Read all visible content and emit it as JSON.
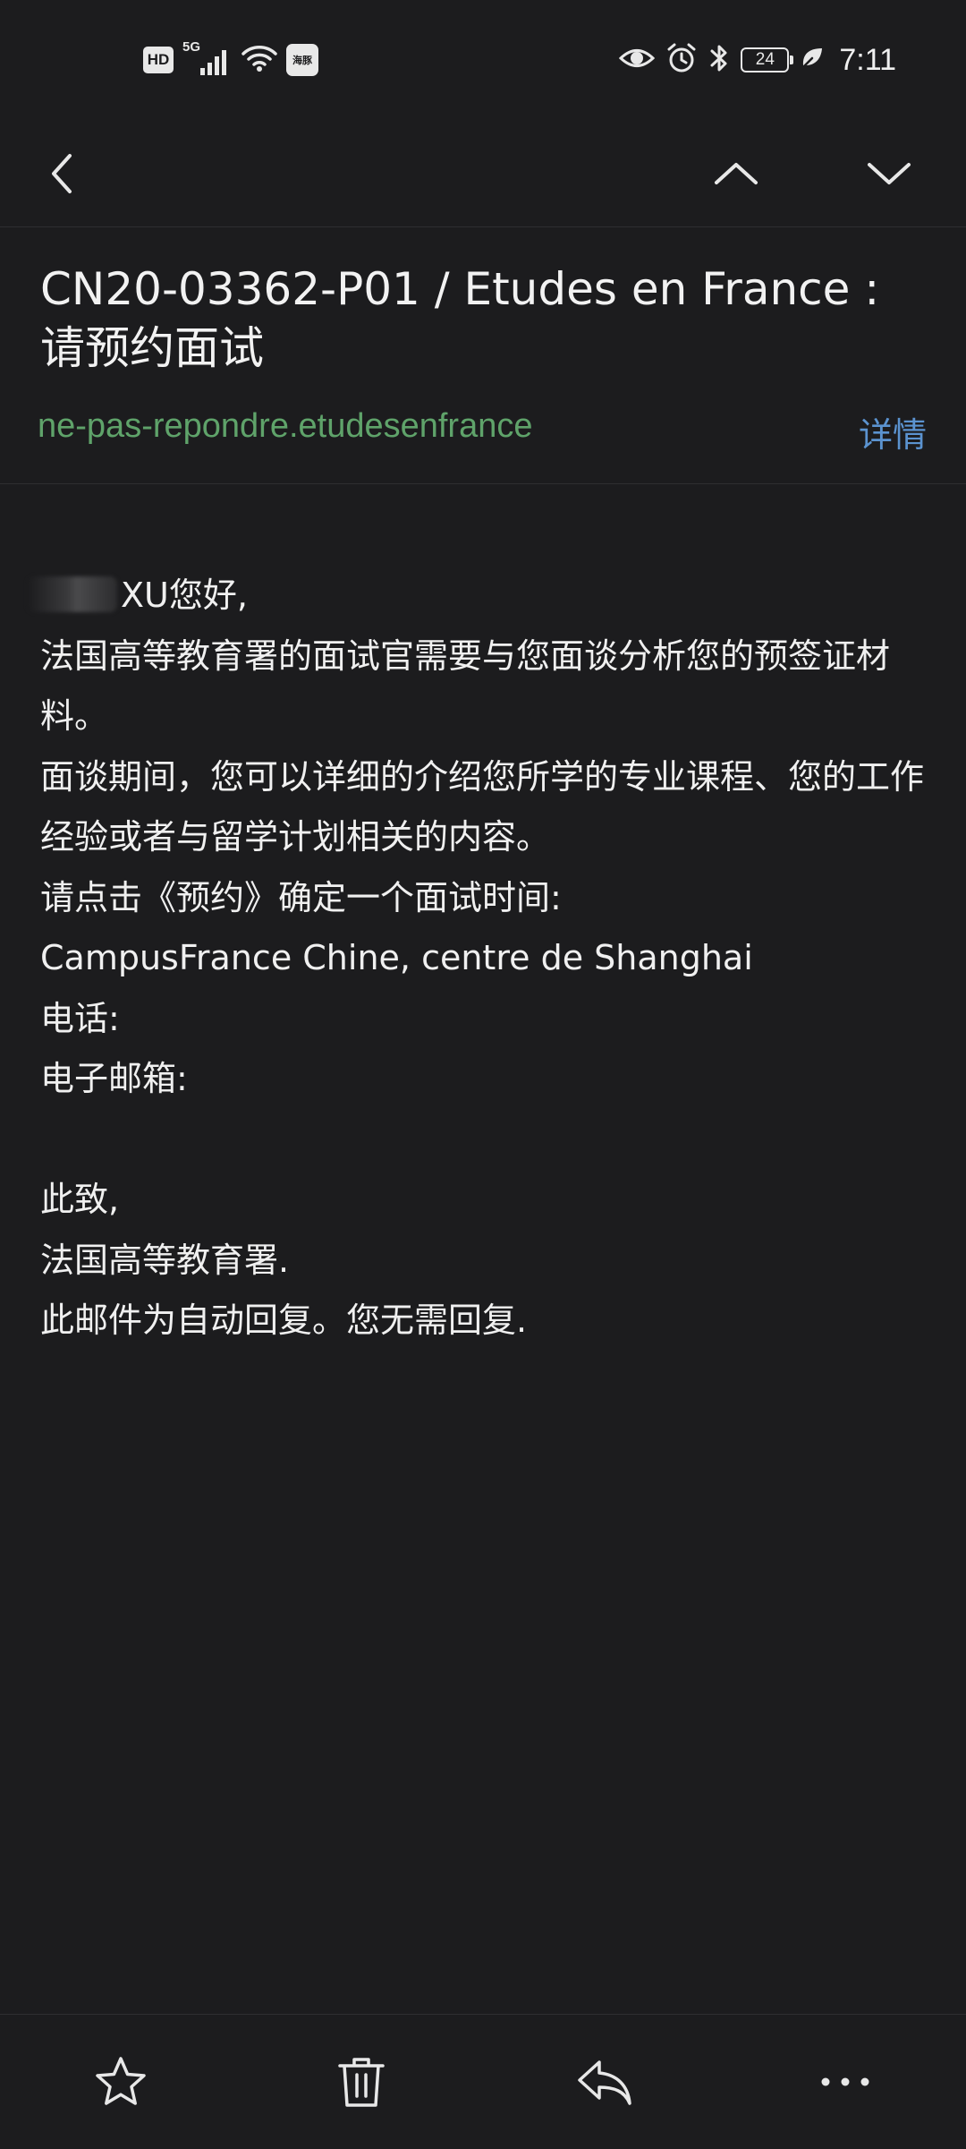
{
  "status_bar": {
    "hd_label": "HD",
    "network_label": "5G",
    "hotspot_label": "海豚",
    "battery_level": "24",
    "time": "7:11"
  },
  "nav": {
    "icons": [
      "back-icon",
      "previous-icon",
      "next-icon"
    ]
  },
  "email": {
    "subject": "CN20-03362-P01 / Etudes en France : 请预约面试",
    "sender": "ne-pas-repondre.etudesenfrance",
    "details_label": "详情",
    "body": {
      "greeting": "XU您好,",
      "lines": [
        "法国高等教育署的面试官需要与您面谈分析您的预签证材料。",
        "面谈期间，您可以详细的介绍您所学的专业课程、您的工作经验或者与留学计划相关的内容。",
        "请点击《预约》确定一个面试时间:",
        "CampusFrance Chine, centre de Shanghai",
        "电话:",
        "电子邮箱:"
      ],
      "closing": [
        "此致,",
        "法国高等教育署.",
        "此邮件为自动回复。您无需回复."
      ]
    }
  },
  "bottom_bar": {
    "icons": [
      "star-icon",
      "trash-icon",
      "reply-icon",
      "more-icon"
    ]
  },
  "colors": {
    "background": "#1c1c1e",
    "text": "#f0f0f0",
    "sender": "#5fa36a",
    "link": "#5b93d0"
  }
}
